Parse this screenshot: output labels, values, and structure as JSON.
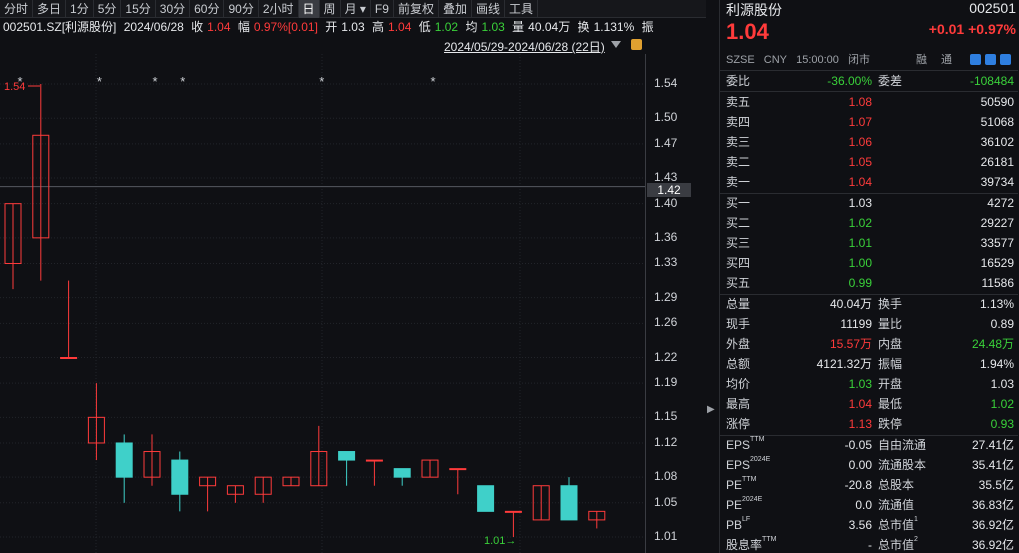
{
  "toolbar": [
    "分时",
    "多日",
    "1分",
    "5分",
    "15分",
    "30分",
    "60分",
    "90分",
    "2小时",
    "日",
    "周",
    "月",
    "F9",
    "前复权",
    "叠加",
    "画线",
    "工具"
  ],
  "toolbar_active": "日",
  "infobar": {
    "code_name": "002501.SZ[利源股份]",
    "date": "2024/06/28",
    "close_label": "收",
    "close": "1.04",
    "amp_label": "幅",
    "amp": "0.97%[0.01]",
    "open_label": "开",
    "open": "1.03",
    "high_label": "高",
    "high": "1.04",
    "low_label": "低",
    "low": "1.02",
    "avg_label": "均",
    "avg": "1.03",
    "vol_label": "量",
    "vol": "40.04万",
    "turn_label": "换",
    "turn": "1.131%",
    "swing_label": "振"
  },
  "range_label": "2024/05/29-2024/06/28 (22日)",
  "cursor_price": "1.42",
  "chart_data": {
    "type": "candlestick",
    "y_ticks": [
      "1.54",
      "1.50",
      "1.47",
      "1.43",
      "1.40",
      "1.36",
      "1.33",
      "1.29",
      "1.26",
      "1.22",
      "1.19",
      "1.15",
      "1.12",
      "1.08",
      "1.05",
      "1.01"
    ],
    "ylim": [
      1.01,
      1.54
    ],
    "max_label": "1.54",
    "min_label": "1.01→",
    "candles": [
      {
        "o": 1.33,
        "h": 1.4,
        "l": 1.3,
        "c": 1.4
      },
      {
        "o": 1.36,
        "h": 1.54,
        "l": 1.31,
        "c": 1.48
      },
      {
        "o": 1.22,
        "h": 1.31,
        "l": 1.22,
        "c": 1.22
      },
      {
        "o": 1.12,
        "h": 1.19,
        "l": 1.1,
        "c": 1.15
      },
      {
        "o": 1.12,
        "h": 1.13,
        "l": 1.05,
        "c": 1.08
      },
      {
        "o": 1.08,
        "h": 1.13,
        "l": 1.07,
        "c": 1.11
      },
      {
        "o": 1.1,
        "h": 1.11,
        "l": 1.04,
        "c": 1.06
      },
      {
        "o": 1.07,
        "h": 1.08,
        "l": 1.04,
        "c": 1.08
      },
      {
        "o": 1.06,
        "h": 1.07,
        "l": 1.05,
        "c": 1.07
      },
      {
        "o": 1.06,
        "h": 1.08,
        "l": 1.05,
        "c": 1.08
      },
      {
        "o": 1.07,
        "h": 1.08,
        "l": 1.07,
        "c": 1.08
      },
      {
        "o": 1.07,
        "h": 1.14,
        "l": 1.07,
        "c": 1.11
      },
      {
        "o": 1.11,
        "h": 1.11,
        "l": 1.07,
        "c": 1.1
      },
      {
        "o": 1.1,
        "h": 1.1,
        "l": 1.07,
        "c": 1.1
      },
      {
        "o": 1.09,
        "h": 1.09,
        "l": 1.07,
        "c": 1.08
      },
      {
        "o": 1.08,
        "h": 1.1,
        "l": 1.08,
        "c": 1.1
      },
      {
        "o": 1.09,
        "h": 1.09,
        "l": 1.06,
        "c": 1.09
      },
      {
        "o": 1.07,
        "h": 1.07,
        "l": 1.04,
        "c": 1.04
      },
      {
        "o": 1.04,
        "h": 1.04,
        "l": 1.01,
        "c": 1.04
      },
      {
        "o": 1.03,
        "h": 1.07,
        "l": 1.03,
        "c": 1.07
      },
      {
        "o": 1.07,
        "h": 1.08,
        "l": 1.03,
        "c": 1.03
      },
      {
        "o": 1.03,
        "h": 1.04,
        "l": 1.02,
        "c": 1.04
      }
    ],
    "markers": [
      "*",
      "*",
      "*",
      "*",
      "*",
      "*"
    ],
    "colors": {
      "up": "#ff3b3b",
      "down": "#3fd0c9"
    }
  },
  "quote": {
    "name": "利源股份",
    "code": "002501",
    "price": "1.04",
    "change": "+0.01",
    "change_pct": "+0.97%",
    "market": "SZSE",
    "currency": "CNY",
    "time": "15:00:00",
    "status": "闭市",
    "margin_label": "融",
    "connect_label": "通"
  },
  "order_book": {
    "ratio_label": "委比",
    "ratio": "-36.00%",
    "diff_label": "委差",
    "diff": "-108484",
    "asks": [
      {
        "label": "卖五",
        "price": "1.08",
        "vol": "50590"
      },
      {
        "label": "卖四",
        "price": "1.07",
        "vol": "51068"
      },
      {
        "label": "卖三",
        "price": "1.06",
        "vol": "36102"
      },
      {
        "label": "卖二",
        "price": "1.05",
        "vol": "26181"
      },
      {
        "label": "卖一",
        "price": "1.04",
        "vol": "39734"
      }
    ],
    "bids": [
      {
        "label": "买一",
        "price": "1.03",
        "vol": "4272"
      },
      {
        "label": "买二",
        "price": "1.02",
        "vol": "29227"
      },
      {
        "label": "买三",
        "price": "1.01",
        "vol": "33577"
      },
      {
        "label": "买四",
        "price": "1.00",
        "vol": "16529"
      },
      {
        "label": "买五",
        "price": "0.99",
        "vol": "11586"
      }
    ]
  },
  "stats": [
    {
      "l1": "总量",
      "v1": "40.04万",
      "c1": "white",
      "l2": "换手",
      "v2": "1.13%",
      "c2": "white"
    },
    {
      "l1": "现手",
      "v1": "11199",
      "c1": "white",
      "l2": "量比",
      "v2": "0.89",
      "c2": "white"
    },
    {
      "l1": "外盘",
      "v1": "15.57万",
      "c1": "red",
      "l2": "内盘",
      "v2": "24.48万",
      "c2": "green"
    },
    {
      "l1": "总额",
      "v1": "4121.32万",
      "c1": "white",
      "l2": "振幅",
      "v2": "1.94%",
      "c2": "white"
    },
    {
      "l1": "均价",
      "v1": "1.03",
      "c1": "green",
      "l2": "开盘",
      "v2": "1.03",
      "c2": "white"
    },
    {
      "l1": "最高",
      "v1": "1.04",
      "c1": "red",
      "l2": "最低",
      "v2": "1.02",
      "c2": "green"
    },
    {
      "l1": "涨停",
      "v1": "1.13",
      "c1": "red",
      "l2": "跌停",
      "v2": "0.93",
      "c2": "green"
    }
  ],
  "fundamentals": [
    {
      "l1": "EPS",
      "s1": "TTM",
      "v1": "-0.05",
      "l2": "自由流通",
      "s2": "",
      "v2": "27.41亿"
    },
    {
      "l1": "EPS",
      "s1": "2024E",
      "v1": "0.00",
      "l2": "流通股本",
      "s2": "",
      "v2": "35.41亿"
    },
    {
      "l1": "PE",
      "s1": "TTM",
      "v1": "-20.8",
      "l2": "总股本",
      "s2": "",
      "v2": "35.5亿"
    },
    {
      "l1": "PE",
      "s1": "2024E",
      "v1": "0.0",
      "l2": "流通值",
      "s2": "",
      "v2": "36.83亿"
    },
    {
      "l1": "PB",
      "s1": "LF",
      "v1": "3.56",
      "l2": "总市值",
      "s2": "1",
      "v2": "36.92亿"
    },
    {
      "l1": "股息率",
      "s1": "TTM",
      "v1": "-",
      "l2": "总市值",
      "s2": "2",
      "v2": "36.92亿"
    }
  ]
}
